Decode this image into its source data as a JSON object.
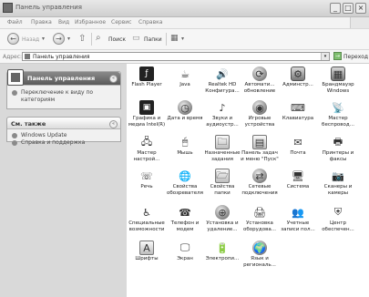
{
  "window": {
    "title": "Панель управления",
    "buttons": [
      "_",
      "□",
      "×"
    ]
  },
  "menu": [
    "Файл",
    "Правка",
    "Вид",
    "Избранное",
    "Сервис",
    "Справка"
  ],
  "toolbar": {
    "back": "Назад",
    "search": "Поиск",
    "folders": "Папки"
  },
  "address": {
    "label": "Адрес:",
    "value": "Панель управления",
    "go": "Переход"
  },
  "sidebar": {
    "cp_panel": {
      "title": "Панель управления",
      "link": "Переключение к виду по категориям"
    },
    "see_also": {
      "title": "См. также",
      "links": [
        "Windows Update",
        "Справка и поддержка"
      ]
    }
  },
  "items": [
    {
      "label1": "Flash Player",
      "label2": "",
      "icon": "flash-player-icon",
      "glyph": "ƒ",
      "style": "i-box"
    },
    {
      "label1": "Java",
      "label2": "",
      "icon": "java-icon",
      "glyph": "☕",
      "style": ""
    },
    {
      "label1": "Realtek HD",
      "label2": "Конфигура...",
      "icon": "speaker-icon",
      "glyph": "🔊",
      "style": ""
    },
    {
      "label1": "Автомати...",
      "label2": "обновление",
      "icon": "auto-update-icon",
      "glyph": "⟳",
      "style": "i-round"
    },
    {
      "label1": "Админстр...",
      "label2": "",
      "icon": "admin-tools-icon",
      "glyph": "⚙",
      "style": "i-mid"
    },
    {
      "label1": "Брандмауэр",
      "label2": "Windows",
      "icon": "firewall-icon",
      "glyph": "▦",
      "style": "i-mid"
    },
    {
      "label1": "Графика и",
      "label2": "медиа Intel(R)",
      "icon": "intel-graphics-icon",
      "glyph": "▣",
      "style": "i-box"
    },
    {
      "label1": "Дата и время",
      "label2": "",
      "icon": "clock-icon",
      "glyph": "◷",
      "style": "i-round"
    },
    {
      "label1": "Звуки и",
      "label2": "аудиоустр...",
      "icon": "sound-icon",
      "glyph": "♪",
      "style": ""
    },
    {
      "label1": "Игровые",
      "label2": "устройства",
      "icon": "gamepad-icon",
      "glyph": "◉",
      "style": "i-round"
    },
    {
      "label1": "Клавиатура",
      "label2": "",
      "icon": "keyboard-icon",
      "glyph": "⌨",
      "style": ""
    },
    {
      "label1": "Мастер",
      "label2": "беспровод...",
      "icon": "wireless-icon",
      "glyph": "📡",
      "style": ""
    },
    {
      "label1": "Мастер",
      "label2": "настрой...",
      "icon": "network-wizard-icon",
      "glyph": "🖧",
      "style": ""
    },
    {
      "label1": "Мышь",
      "label2": "",
      "icon": "mouse-icon",
      "glyph": "🖱",
      "style": ""
    },
    {
      "label1": "Назначенные",
      "label2": "задания",
      "icon": "scheduled-tasks-icon",
      "glyph": "🗀",
      "style": "i-light"
    },
    {
      "label1": "Панель задач",
      "label2": "и меню \"Пуск\"",
      "icon": "taskbar-icon",
      "glyph": "▤",
      "style": "i-light"
    },
    {
      "label1": "Почта",
      "label2": "",
      "icon": "mail-icon",
      "glyph": "✉",
      "style": ""
    },
    {
      "label1": "Принтеры и",
      "label2": "факсы",
      "icon": "printer-icon",
      "glyph": "🖶",
      "style": ""
    },
    {
      "label1": "Речь",
      "label2": "",
      "icon": "speech-icon",
      "glyph": "☏",
      "style": ""
    },
    {
      "label1": "Свойства",
      "label2": "обозревателя",
      "icon": "internet-options-icon",
      "glyph": "🌐",
      "style": ""
    },
    {
      "label1": "Свойства",
      "label2": "папки",
      "icon": "folder-options-icon",
      "glyph": "🗁",
      "style": "i-light"
    },
    {
      "label1": "Сетевые",
      "label2": "подключения",
      "icon": "network-connections-icon",
      "glyph": "⇄",
      "style": "i-round"
    },
    {
      "label1": "Система",
      "label2": "",
      "icon": "system-icon",
      "glyph": "🖥",
      "style": ""
    },
    {
      "label1": "Сканеры и",
      "label2": "камеры",
      "icon": "scanner-icon",
      "glyph": "📷",
      "style": ""
    },
    {
      "label1": "Специальные",
      "label2": "возможности",
      "icon": "accessibility-icon",
      "glyph": "♿",
      "style": ""
    },
    {
      "label1": "Телефон и",
      "label2": "модем",
      "icon": "phone-modem-icon",
      "glyph": "☎",
      "style": ""
    },
    {
      "label1": "Установка и",
      "label2": "удаление...",
      "icon": "add-remove-icon",
      "glyph": "⊕",
      "style": "i-round"
    },
    {
      "label1": "Установка",
      "label2": "оборудова...",
      "icon": "add-hardware-icon",
      "glyph": "🖨",
      "style": ""
    },
    {
      "label1": "Учетные",
      "label2": "записи пол...",
      "icon": "user-accounts-icon",
      "glyph": "👥",
      "style": ""
    },
    {
      "label1": "Центр",
      "label2": "обеспечен...",
      "icon": "security-center-icon",
      "glyph": "⛨",
      "style": ""
    },
    {
      "label1": "Шрифты",
      "label2": "",
      "icon": "fonts-icon",
      "glyph": "A",
      "style": "i-light"
    },
    {
      "label1": "Экран",
      "label2": "",
      "icon": "display-icon",
      "glyph": "🖵",
      "style": ""
    },
    {
      "label1": "Электропи...",
      "label2": "",
      "icon": "power-options-icon",
      "glyph": "🔋",
      "style": ""
    },
    {
      "label1": "Язык и",
      "label2": "региональ...",
      "icon": "language-icon",
      "glyph": "🌍",
      "style": "i-round"
    }
  ]
}
